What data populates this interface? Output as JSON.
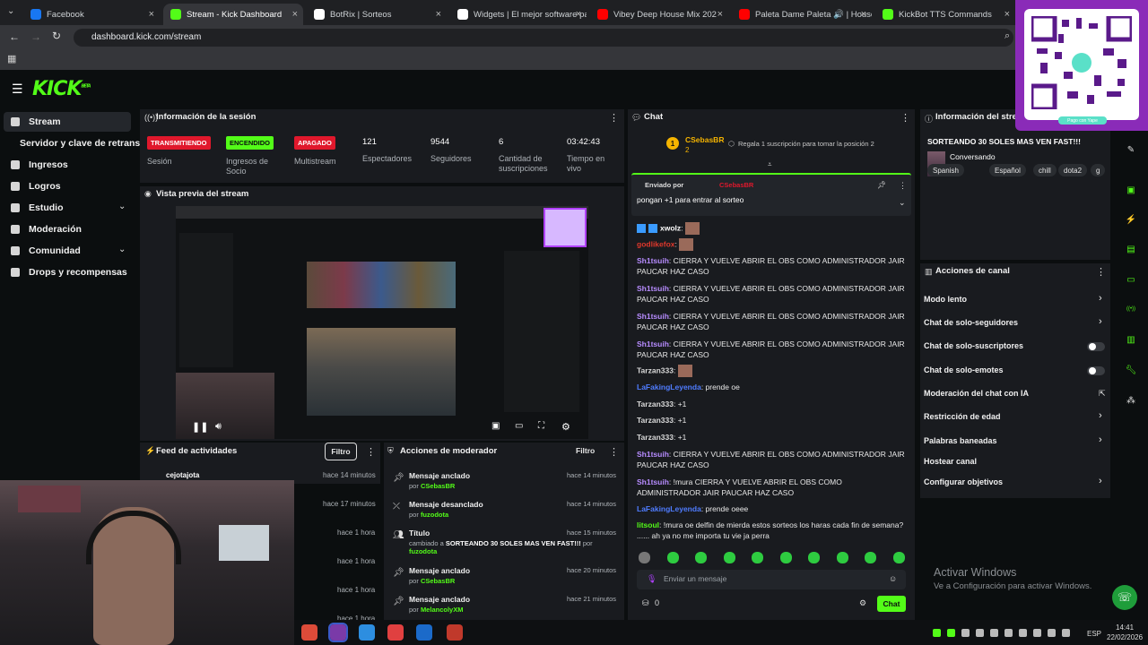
{
  "browser": {
    "tabs": [
      {
        "label": "Facebook",
        "color": "#1877f2",
        "active": false
      },
      {
        "label": "Stream - Kick Dashboard",
        "color": "#53fc18",
        "active": true
      },
      {
        "label": "BotRix | Sorteos",
        "color": "#ffffff",
        "active": false
      },
      {
        "label": "Widgets | El mejor software pa",
        "color": "#ffffff",
        "active": false
      },
      {
        "label": "Vibey Deep House Mix 202",
        "color": "#ff0000",
        "active": false
      },
      {
        "label": "Paleta Dame Paleta 🔊 | House",
        "color": "#ff0000",
        "active": false
      },
      {
        "label": "KickBot TTS Commands",
        "color": "#53fc18",
        "active": false
      }
    ],
    "url": "dashboard.kick.com/stream"
  },
  "app": {
    "logo": "KICK",
    "logo_sup": "BETA"
  },
  "sidebar": {
    "items": [
      {
        "label": "Stream",
        "icon": "broadcast-icon",
        "active": true
      },
      {
        "label": "Servidor y clave de retransmisión",
        "icon": "",
        "active": false
      },
      {
        "label": "Ingresos",
        "icon": "money-icon",
        "active": false
      },
      {
        "label": "Logros",
        "icon": "trophy-icon",
        "active": false
      },
      {
        "label": "Estudio",
        "icon": "studio-icon",
        "active": false
      },
      {
        "label": "Moderación",
        "icon": "shield-icon",
        "active": false
      },
      {
        "label": "Comunidad",
        "icon": "community-icon",
        "active": false
      },
      {
        "label": "Drops y recompensas",
        "icon": "gift-icon",
        "active": false
      }
    ]
  },
  "session": {
    "title": "Información de la sesión",
    "badges": [
      {
        "text": "TRANSMITIENDO",
        "bg": "#e0182c",
        "fg": "#ffffff",
        "label": "Sesión"
      },
      {
        "text": "ENCENDIDO",
        "bg": "#53fc18",
        "fg": "#0b0e0f",
        "label": "Ingresos de Socio"
      },
      {
        "text": "APAGADO",
        "bg": "#e0182c",
        "fg": "#ffffff",
        "label": "Multistream"
      }
    ],
    "stats": [
      {
        "value": "121",
        "label": "Espectadores"
      },
      {
        "value": "9544",
        "label": "Seguidores"
      },
      {
        "value": "6",
        "label": "Cantidad de suscripciones"
      },
      {
        "value": "03:42:43",
        "label": "Tiempo en vivo"
      }
    ]
  },
  "preview": {
    "title": "Vista previa del stream"
  },
  "feed": {
    "title": "Feed de actividades",
    "filter": "Filtro",
    "rows": [
      {
        "user": "cejotajota",
        "time": "hace 14 minutos"
      },
      {
        "user": "",
        "time": "hace 17 minutos"
      },
      {
        "user": "",
        "time": "hace 1 hora"
      },
      {
        "user": "",
        "time": "hace 1 hora"
      },
      {
        "user": "",
        "time": "hace 1 hora"
      },
      {
        "user": "",
        "time": "hace 1 hora"
      }
    ]
  },
  "modactions": {
    "title": "Acciones de moderador",
    "filter": "Filtro",
    "rows": [
      {
        "icon": "pin-icon",
        "title": "Mensaje anclado",
        "by": "por",
        "user": "CSebasBR",
        "detail": "",
        "time": "hace 14 minutos"
      },
      {
        "icon": "unpin-icon",
        "title": "Mensaje desanclado",
        "by": "por",
        "user": "fuzodota",
        "detail": "",
        "time": "hace 14 minutos"
      },
      {
        "icon": "title-icon",
        "title": "Título",
        "by": "cambiado a",
        "user": "fuzodota",
        "detail": "SORTEANDO 30 SOLES MAS VEN FAST!!!",
        "time": "hace 15 minutos"
      },
      {
        "icon": "pin-icon",
        "title": "Mensaje anclado",
        "by": "por",
        "user": "CSebasBR",
        "detail": "",
        "time": "hace 20 minutos"
      },
      {
        "icon": "pin-icon",
        "title": "Mensaje anclado",
        "by": "por",
        "user": "MelancolyXM",
        "detail": "",
        "time": "hace 21 minutos"
      }
    ]
  },
  "chat": {
    "title": "Chat",
    "top_gifter": {
      "rank": "1",
      "user": "CSebasBR",
      "count": "2",
      "hint": "Regala 1 suscripción para tomar la posición 2"
    },
    "pinned": {
      "prefix": "Enviado por",
      "user": "CSebasBR",
      "message": "pongan +1 para entrar al sorteo"
    },
    "messages": [
      {
        "user": "xwolz",
        "color": "#ffffff",
        "text": ""
      },
      {
        "user": "godlikefox",
        "color": "#e0382c",
        "text": ""
      },
      {
        "user": "Sh1tsuih",
        "color": "#b78cff",
        "text": "CIERRA Y VUELVE ABRIR EL OBS COMO ADMINISTRADOR JAIR PAUCAR HAZ CASO"
      },
      {
        "user": "Sh1tsuih",
        "color": "#b78cff",
        "text": "CIERRA Y VUELVE ABRIR EL OBS COMO ADMINISTRADOR JAIR PAUCAR HAZ CASO"
      },
      {
        "user": "Sh1tsuih",
        "color": "#b78cff",
        "text": "CIERRA Y VUELVE ABRIR EL OBS COMO ADMINISTRADOR JAIR PAUCAR HAZ CASO"
      },
      {
        "user": "Sh1tsuih",
        "color": "#b78cff",
        "text": "CIERRA Y VUELVE ABRIR EL OBS COMO ADMINISTRADOR JAIR PAUCAR HAZ CASO"
      },
      {
        "user": "Tarzan333",
        "color": "#d9d9d9",
        "text": ""
      },
      {
        "user": "LaFakingLeyenda",
        "color": "#4f7cff",
        "text": "prende oe"
      },
      {
        "user": "Tarzan333",
        "color": "#d9d9d9",
        "text": "+1"
      },
      {
        "user": "Tarzan333",
        "color": "#d9d9d9",
        "text": "+1"
      },
      {
        "user": "Tarzan333",
        "color": "#d9d9d9",
        "text": "+1"
      },
      {
        "user": "Sh1tsuih",
        "color": "#b78cff",
        "text": "CIERRA Y VUELVE ABRIR EL OBS COMO ADMINISTRADOR JAIR PAUCAR HAZ CASO"
      },
      {
        "user": "Sh1tsuih",
        "color": "#b78cff",
        "text": "!mura CIERRA Y VUELVE ABRIR EL OBS COMO ADMINISTRADOR JAIR PAUCAR HAZ CASO"
      },
      {
        "user": "LaFakingLeyenda",
        "color": "#4f7cff",
        "text": "prende oeee"
      },
      {
        "user": "litsoul",
        "color": "#53fc18",
        "text": "!mura oe delfin de mierda estos sorteos los haras cada fin de semana? ...... ah ya no me importa tu vie ja perra"
      }
    ],
    "input_placeholder": "Enviar un mensaje",
    "send": "Chat",
    "points": "0"
  },
  "stream_info": {
    "title": "Información del stream",
    "stream_title": "SORTEANDO 30 SOLES MAS VEN FAST!!!",
    "category": "Conversando",
    "tags": [
      "Spanish",
      "Español",
      "chill",
      "dota2",
      "g"
    ]
  },
  "channel_actions": {
    "title": "Acciones de canal",
    "items": [
      {
        "label": "Modo lento",
        "control": "chevron"
      },
      {
        "label": "Chat de solo-seguidores",
        "control": "chevron"
      },
      {
        "label": "Chat de solo-suscriptores",
        "control": "toggle"
      },
      {
        "label": "Chat de solo-emotes",
        "control": "toggle"
      },
      {
        "label": "Moderación del chat con IA",
        "control": "external"
      },
      {
        "label": "Restricción de edad",
        "control": "chevron"
      },
      {
        "label": "Palabras baneadas",
        "control": "chevron"
      },
      {
        "label": "Hostear canal",
        "control": "none"
      },
      {
        "label": "Configurar objetivos",
        "control": "chevron"
      }
    ]
  },
  "overlay": {
    "qr_caption": "Pago con Yape"
  },
  "windows": {
    "activate_title": "Activar Windows",
    "activate_sub": "Ve a Configuración para activar Windows.",
    "time": "14:41",
    "date": "22/02/2026",
    "lang": "ESP"
  }
}
